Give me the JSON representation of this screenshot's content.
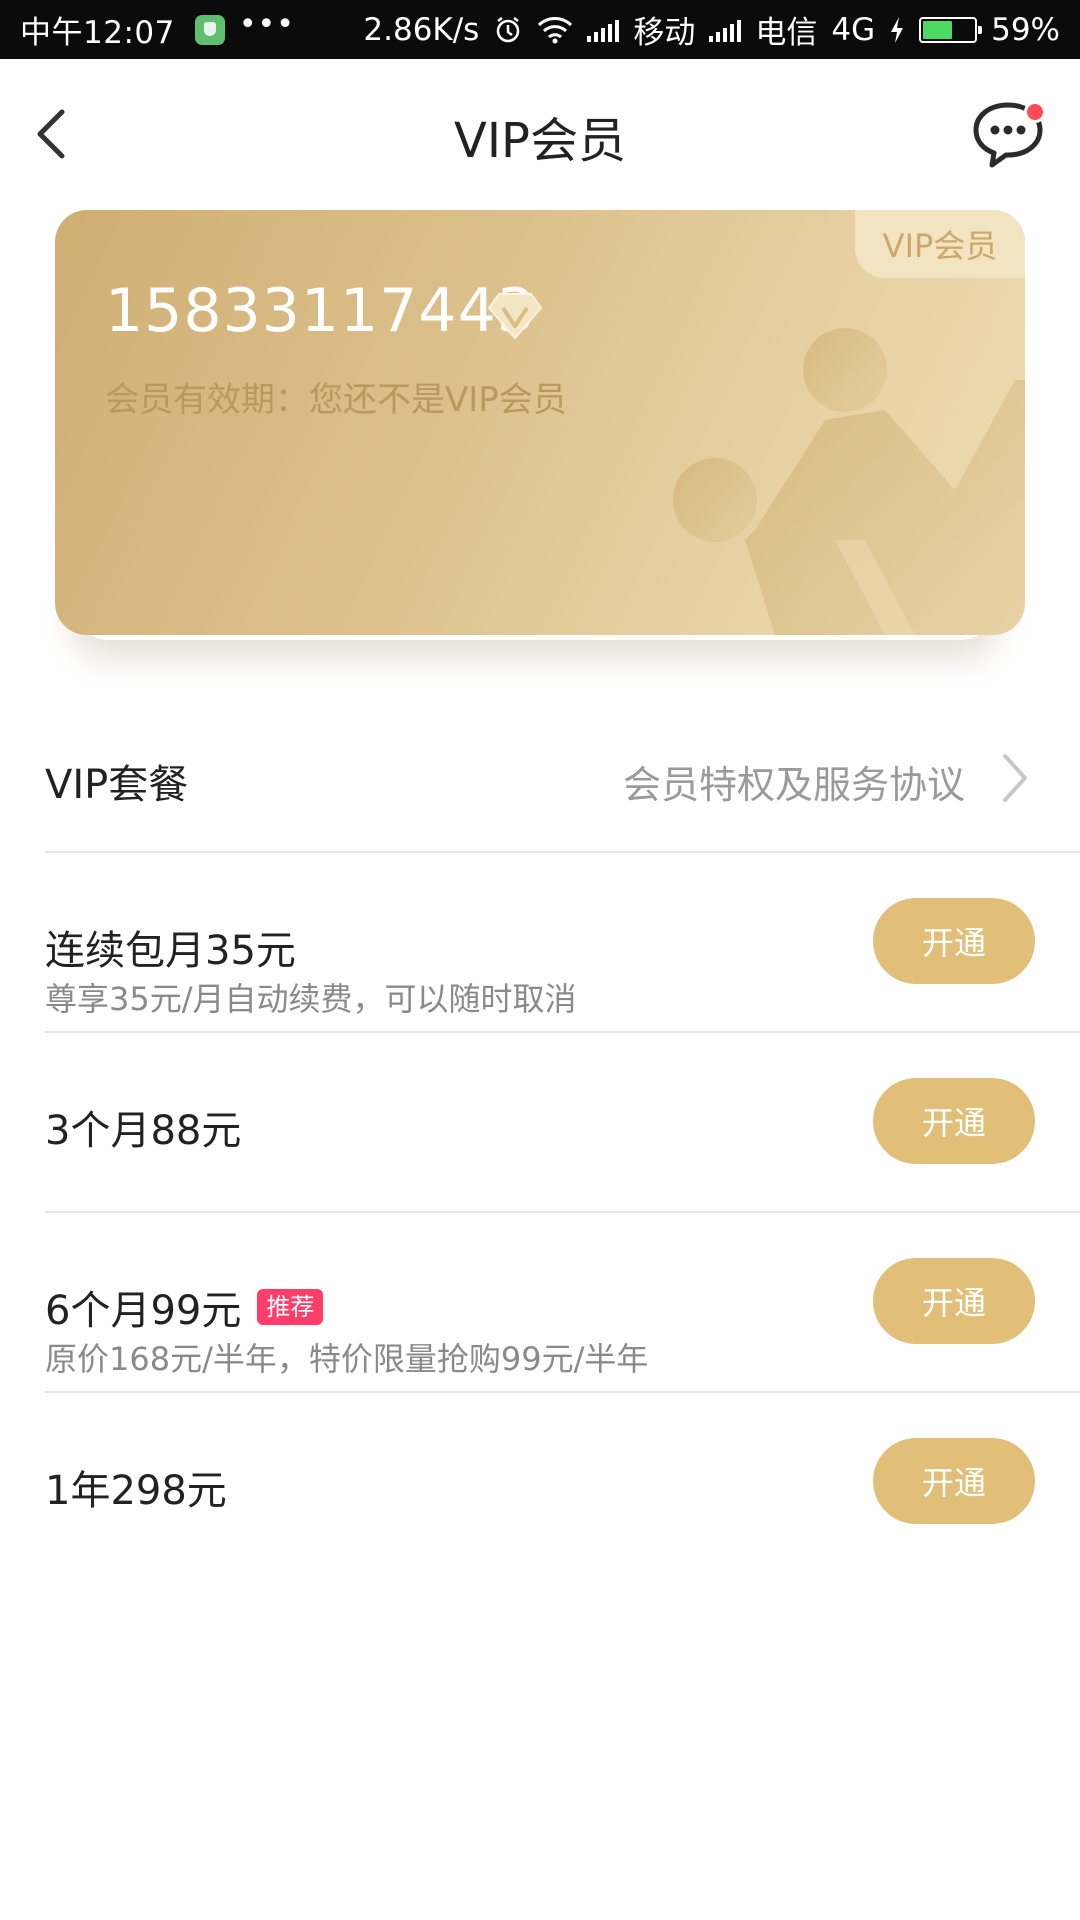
{
  "status_bar": {
    "time": "中午12:07",
    "dots": "•••",
    "speed": "2.86K/s",
    "carrier1": "移动",
    "carrier2": "电信",
    "network": "4G",
    "battery": "59%",
    "battery_level": 0.59
  },
  "header": {
    "title": "VIP会员"
  },
  "card": {
    "tag": "VIP会员",
    "phone": "15833117443",
    "validity": "会员有效期：您还不是VIP会员"
  },
  "packages": {
    "title": "VIP套餐",
    "link": "会员特权及服务协议"
  },
  "plans": [
    {
      "name": "连续包月35元",
      "desc": "尊享35元/月自动续费，可以随时取消",
      "button": "开通"
    },
    {
      "name": "3个月88元",
      "button": "开通"
    },
    {
      "name": "6个月99元",
      "badge": "推荐",
      "desc": "原价168元/半年，特价限量抢购99元/半年",
      "button": "开通"
    },
    {
      "name": "1年298元",
      "button": "开通"
    }
  ],
  "colors": {
    "gold": "#e2bf78",
    "badge": "#ff3d6a",
    "notification": "#ff4b55"
  }
}
